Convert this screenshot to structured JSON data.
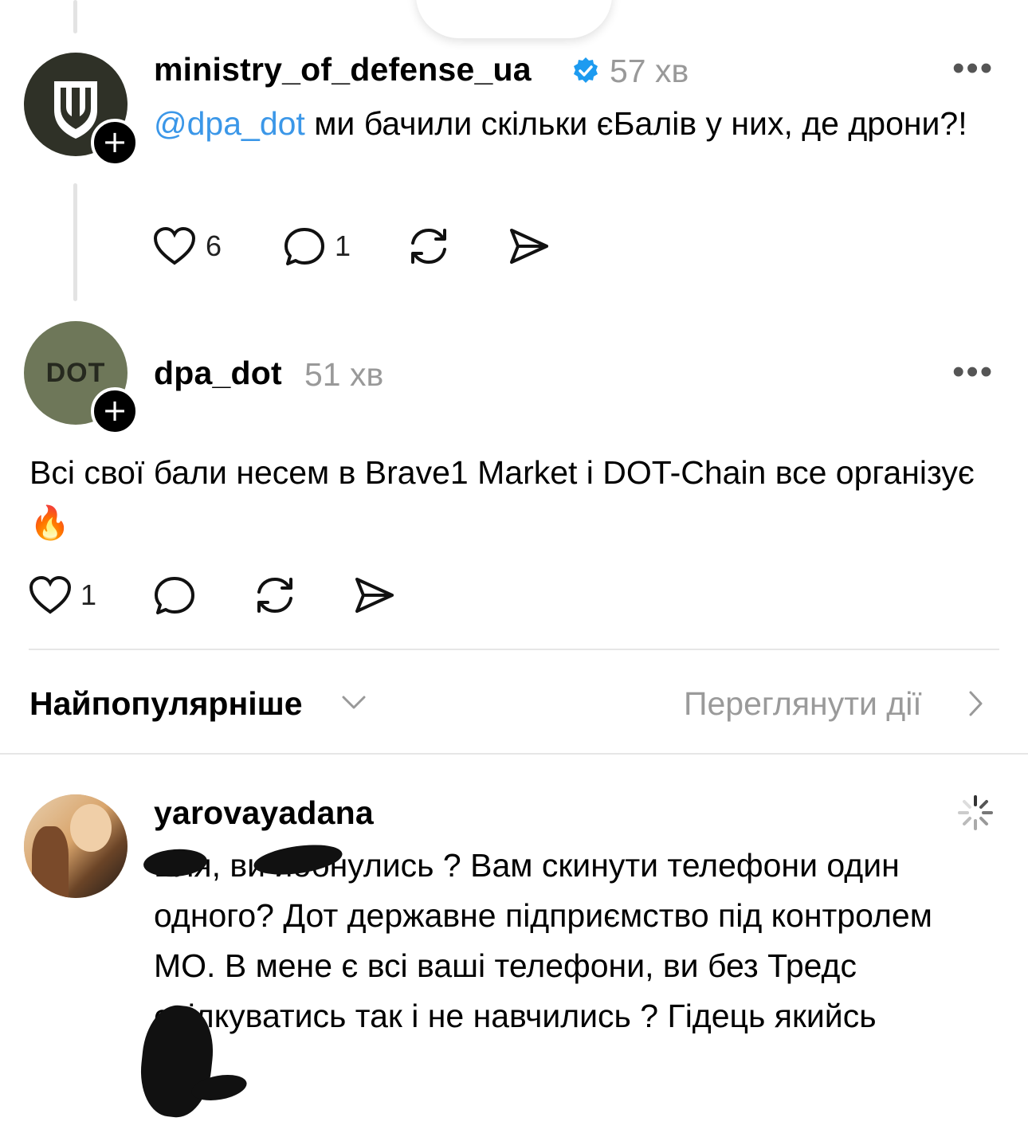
{
  "top_stack": {
    "avatars": [
      "shield-avatar",
      "red-avatar",
      "plus-avatar"
    ]
  },
  "posts": [
    {
      "username": "ministry_of_defense_ua",
      "verified": true,
      "time": "57 хв",
      "mention": "@dpa_dot",
      "text": " ми бачили скільки єБалів у них, де дрони?!",
      "likes": "6",
      "replies": "1"
    },
    {
      "username": "dpa_dot",
      "avatar_text": "DOT",
      "time": "51 хв",
      "text": "Всі свої бали несем в Brave1 Market і DOT-Chain все організує🔥",
      "likes": "1"
    }
  ],
  "sort": {
    "label": "Найпопулярніше",
    "activity_link": "Переглянути дії"
  },
  "comment": {
    "username": "yarovayadana",
    "text": "Бля, ви йобнулись ? Вам скинути телефони один одного? Дот державне підприємство під контролем МО.  В мене є всі ваші телефони, ви без Тредс спілкуватись так і не навчились ? Гідець якийсь"
  },
  "colors": {
    "accent": "#3b97e8",
    "muted": "#999999",
    "verified": "#1d9bf0",
    "dot_avatar": "#6e7759"
  }
}
